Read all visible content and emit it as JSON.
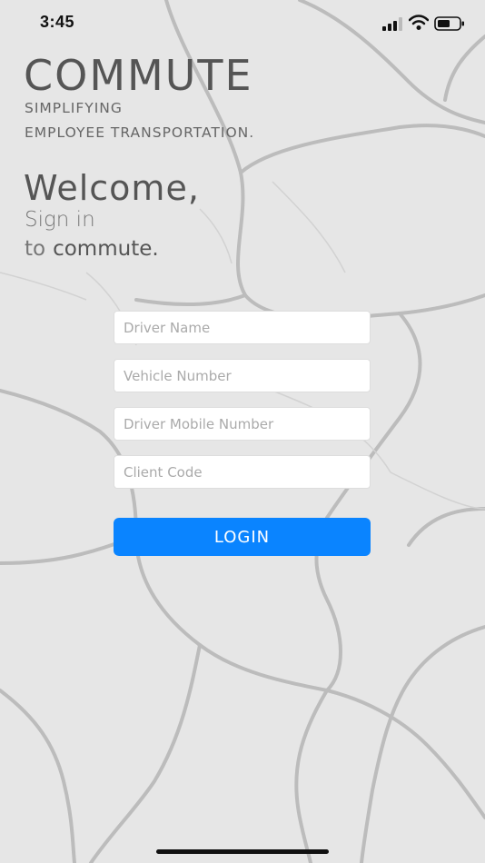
{
  "status_bar": {
    "time": "3:45"
  },
  "brand": {
    "name": "COMMUTE",
    "tagline_line1": "SIMPLIFYING",
    "tagline_line2": "EMPLOYEE TRANSPORTATION."
  },
  "greeting": {
    "welcome": "Welcome,",
    "sign_in": "Sign in",
    "to": "to",
    "app_name": "commute."
  },
  "form": {
    "driver_name_placeholder": "Driver Name",
    "vehicle_number_placeholder": "Vehicle Number",
    "driver_mobile_placeholder": "Driver Mobile Number",
    "client_code_placeholder": "Client Code",
    "login_label": "LOGIN"
  },
  "colors": {
    "background": "#e6e6e6",
    "map_roads": "#bdbdbd",
    "accent": "#0a84ff"
  }
}
